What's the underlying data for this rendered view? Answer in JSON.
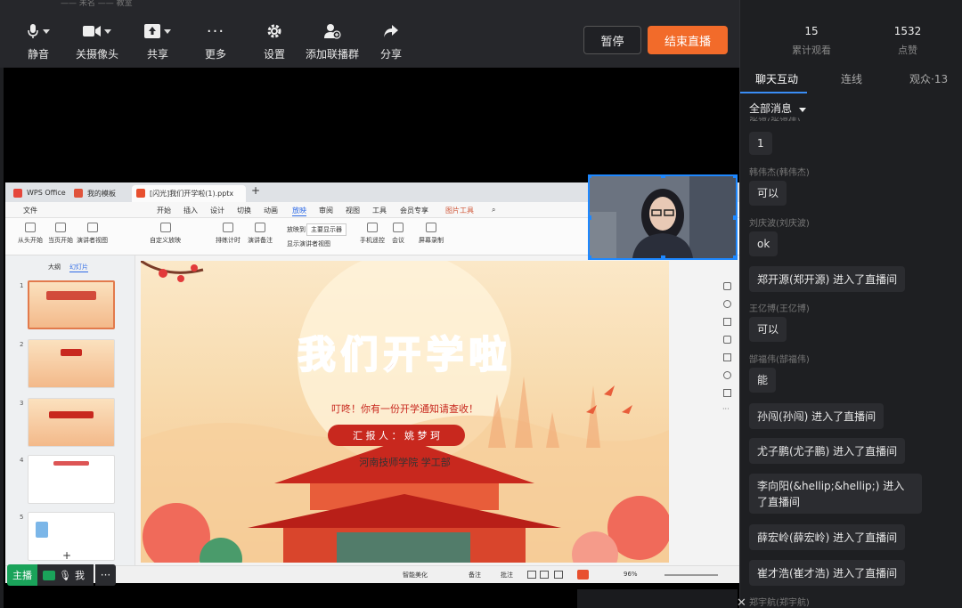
{
  "title_strip": {
    "text": "—— 未名 —— 教室"
  },
  "toolbar": {
    "items": [
      {
        "label": "静音",
        "icon": "microphone-icon"
      },
      {
        "label": "关摄像头",
        "icon": "camera-icon"
      },
      {
        "label": "共享",
        "icon": "share-screen-icon"
      },
      {
        "label": "更多",
        "icon": "more-icon"
      },
      {
        "label": "设置",
        "icon": "gear-icon"
      },
      {
        "label": "添加联播群",
        "icon": "add-group-icon"
      },
      {
        "label": "分享",
        "icon": "share-arrow-icon"
      }
    ],
    "pause_label": "暂停",
    "end_label": "结束直播"
  },
  "stats": {
    "viewers_count": "15",
    "viewers_label": "累计观看",
    "likes_count": "1532",
    "likes_label": "点赞"
  },
  "tabs": {
    "chat": "聊天互动",
    "connect": "连线",
    "audience": "观众·13"
  },
  "filter": {
    "label": "全部消息"
  },
  "chat": [
    {
      "user": "张福(张福伟)",
      "message": "1"
    },
    {
      "user": "韩伟杰(韩伟杰)",
      "message": "可以"
    },
    {
      "user": "刘庆波(刘庆波)",
      "message": "ok"
    },
    {
      "user": "",
      "message": "郑开源(郑开源) 进入了直播间"
    },
    {
      "user": "王亿博(王亿博)",
      "message": "可以"
    },
    {
      "user": "郜福伟(郜福伟)",
      "message": "能"
    },
    {
      "user": "",
      "message": "孙闯(孙闯) 进入了直播间"
    },
    {
      "user": "",
      "message": "尤子鹏(尤子鹏) 进入了直播间"
    },
    {
      "user": "",
      "message": "李向阳(&hellip;&hellip;) 进入了直播间"
    },
    {
      "user": "",
      "message": "薛宏岭(薛宏岭) 进入了直播间"
    },
    {
      "user": "",
      "message": "崔才浩(崔才浩) 进入了直播间"
    },
    {
      "user": "郑宇航(郑宇航)",
      "message": ""
    }
  ],
  "wps": {
    "tabs": [
      "WPS Office",
      "我的模板",
      "[闪光]我们开学啦(1).pptx"
    ],
    "menu": [
      "文件",
      "开始",
      "插入",
      "设计",
      "切换",
      "动画",
      "放映",
      "审阅",
      "视图",
      "工具",
      "会员专享",
      "图片工具"
    ],
    "ribbon": [
      "从头开始",
      "当页开始",
      "演讲者视图",
      "自定义放映",
      "排练计时",
      "演讲备注",
      "放映到",
      "主要显示器",
      "显示演讲者视图",
      "手机遥控",
      "会议",
      "屏幕录制"
    ],
    "panel_tabs": [
      "大纲",
      "幻灯片"
    ],
    "thumbs": [
      "1",
      "2",
      "3",
      "4",
      "5"
    ],
    "slide": {
      "title": "我们开学啦",
      "subtitle": "叮咚！你有一份开学通知请查收！",
      "reporter": "汇 报 人 ： 姚 梦 珂",
      "org": "河南技师学院  学工部"
    },
    "status": {
      "beautify": "智能美化",
      "notes": "备注",
      "comments": "批注",
      "zoom": "96%"
    }
  },
  "hostbar": {
    "host": "主播",
    "me": "我"
  },
  "colors": {
    "accent": "#f26b2a",
    "blue": "#3a8df5",
    "green": "#1aa35a",
    "slide_red": "#c8281e"
  }
}
